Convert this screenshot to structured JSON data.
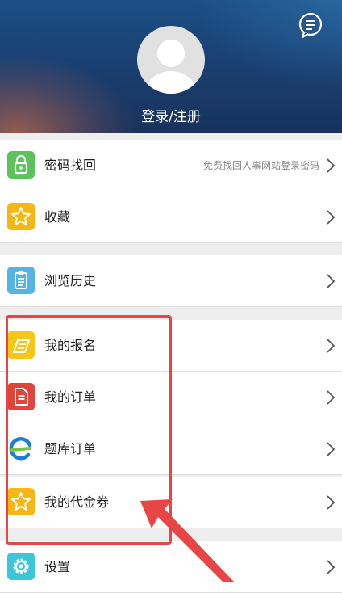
{
  "header": {
    "login_text": "登录/注册"
  },
  "menu": [
    {
      "label": "密码找回",
      "hint": "免费找回人事网站登录密码",
      "icon": "lock-icon",
      "color": "#5cc25c"
    },
    {
      "label": "收藏",
      "icon": "star-icon",
      "color": "#f6b715"
    },
    {
      "label": "浏览历史",
      "icon": "clipboard-icon",
      "color": "#54b4e4"
    },
    {
      "label": "我的报名",
      "icon": "pen-icon",
      "color": "#f6c619"
    },
    {
      "label": "我的订单",
      "icon": "document-icon",
      "color": "#e0443a"
    },
    {
      "label": "题库订单",
      "icon": "e-logo-icon"
    },
    {
      "label": "我的代金券",
      "icon": "star-icon",
      "color": "#f6b715"
    },
    {
      "label": "设置",
      "icon": "gear-icon",
      "color": "#3cc6d8"
    }
  ],
  "annotation": {
    "color": "#e84545"
  }
}
